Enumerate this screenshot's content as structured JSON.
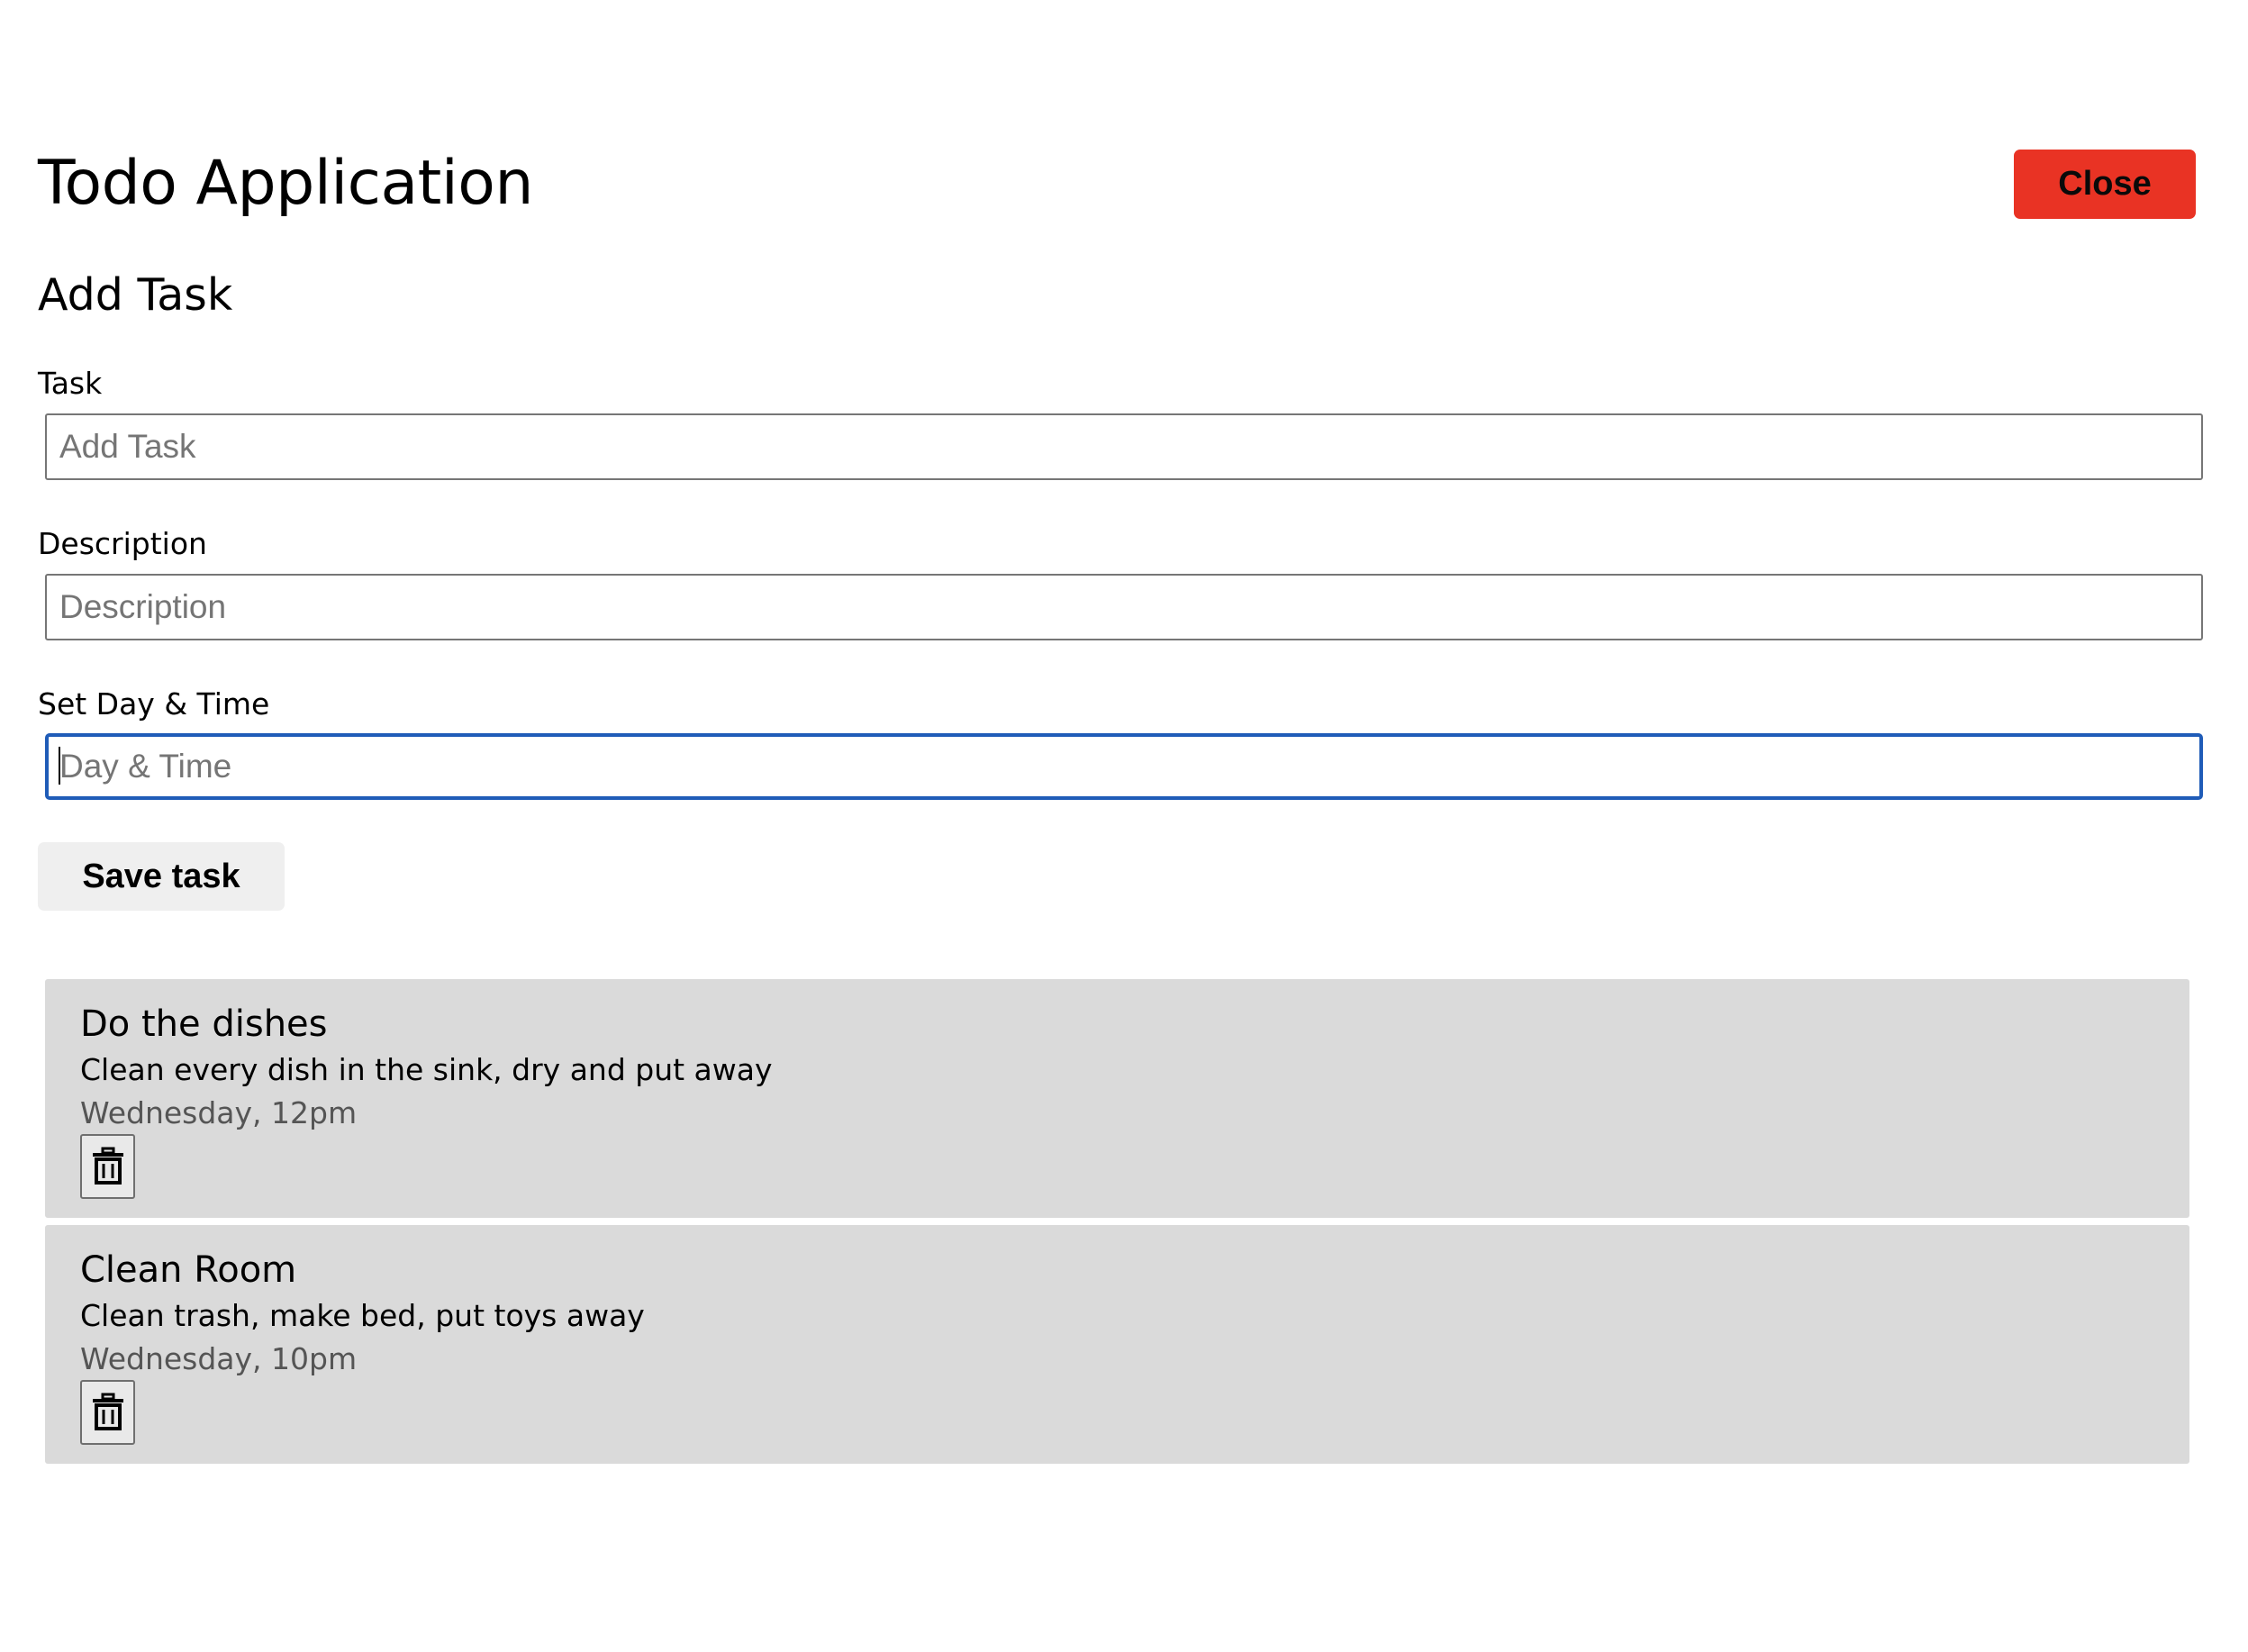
{
  "header": {
    "title": "Todo Application",
    "close_label": "Close"
  },
  "form": {
    "section_title": "Add Task",
    "task": {
      "label": "Task",
      "placeholder": "Add Task",
      "value": ""
    },
    "description": {
      "label": "Description",
      "placeholder": "Description",
      "value": ""
    },
    "day_time": {
      "label": "Set Day & Time",
      "placeholder": "Day & Time",
      "value": "",
      "focused": true
    },
    "save_label": "Save task"
  },
  "tasks": [
    {
      "name": "Do the dishes",
      "description": "Clean every dish in the sink, dry and put away",
      "day_time": "Wednesday, 12pm",
      "delete_icon": "trash-icon"
    },
    {
      "name": "Clean Room",
      "description": "Clean trash, make bed, put toys away",
      "day_time": "Wednesday, 10pm",
      "delete_icon": "trash-icon"
    }
  ],
  "colors": {
    "close_button": "#e93324",
    "save_button": "#efefef",
    "task_card": "#dadada",
    "focus_border": "#1f5cb8"
  }
}
